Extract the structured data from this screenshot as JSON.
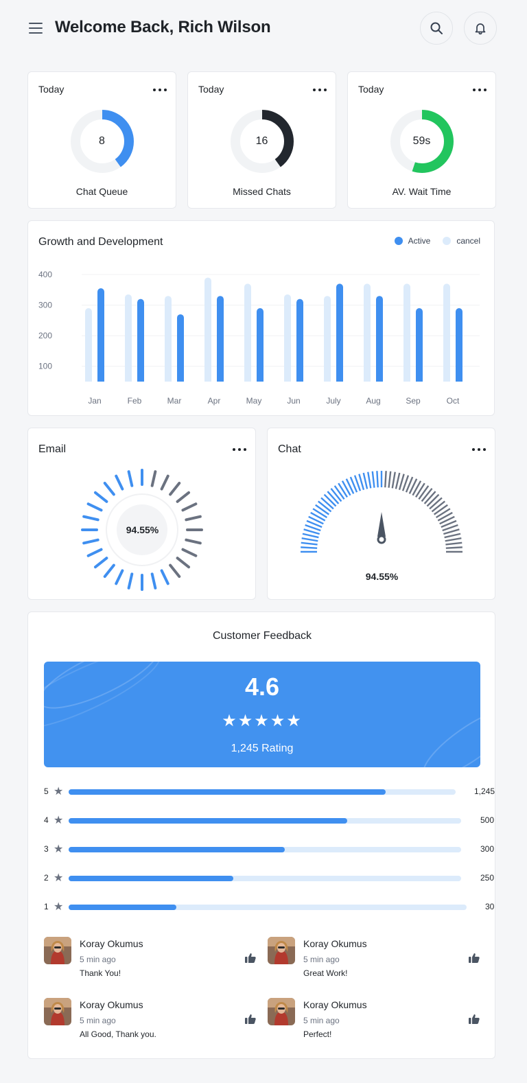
{
  "header": {
    "title": "Welcome Back, Rich Wilson"
  },
  "stats": [
    {
      "period": "Today",
      "value": "8",
      "label": "Chat Queue",
      "progress": 0.4,
      "color": "#3f8ff0"
    },
    {
      "period": "Today",
      "value": "16",
      "label": "Missed Chats",
      "progress": 0.4,
      "color": "#22272e"
    },
    {
      "period": "Today",
      "value": "59s",
      "label": "AV. Wait Time",
      "progress": 0.55,
      "color": "#22c55e"
    }
  ],
  "growth": {
    "title": "Growth and Development",
    "legend": {
      "active": "Active",
      "cancel": "cancel"
    },
    "colors": {
      "active": "#3f8ff0",
      "cancel": "#dcebfb"
    }
  },
  "chart_data": {
    "type": "bar",
    "title": "Growth and Development",
    "categories": [
      "Jan",
      "Feb",
      "Mar",
      "Apr",
      "May",
      "Jun",
      "July",
      "Aug",
      "Sep",
      "Oct"
    ],
    "series": [
      {
        "name": "cancel",
        "values": [
          290,
          335,
          330,
          390,
          370,
          335,
          330,
          370,
          370,
          370
        ]
      },
      {
        "name": "Active",
        "values": [
          355,
          320,
          270,
          330,
          290,
          320,
          370,
          330,
          290,
          290
        ]
      }
    ],
    "yticks": [
      100,
      200,
      300,
      400
    ],
    "ylim": [
      50,
      400
    ],
    "legend_position": "top-right"
  },
  "email": {
    "title": "Email",
    "value": "94.55%",
    "progress": 0.6,
    "colors": {
      "filled": "#3f8ff0",
      "rest": "#6b7280"
    }
  },
  "chat": {
    "title": "Chat",
    "value": "94.55%",
    "progress": 0.5,
    "colors": {
      "filled": "#3f8ff0",
      "rest": "#6b7280"
    }
  },
  "feedback": {
    "title": "Customer Feedback",
    "score": "4.6",
    "stars": "★★★★★",
    "rating_count": "1,245 Rating",
    "rows": [
      {
        "stars": "5",
        "count": "1,245",
        "fill": 0.82
      },
      {
        "stars": "4",
        "count": "500",
        "fill": 0.71
      },
      {
        "stars": "3",
        "count": "300",
        "fill": 0.55
      },
      {
        "stars": "2",
        "count": "250",
        "fill": 0.42
      },
      {
        "stars": "1",
        "count": "30",
        "fill": 0.27
      }
    ],
    "reviews": [
      {
        "name": "Koray Okumus",
        "time": "5 min ago",
        "text": "Thank You!"
      },
      {
        "name": "Koray Okumus",
        "time": "5 min ago",
        "text": "Great Work!"
      },
      {
        "name": "Koray Okumus",
        "time": "5 min ago",
        "text": "All Good, Thank you."
      },
      {
        "name": "Koray Okumus",
        "time": "5 min ago",
        "text": "Perfect!"
      }
    ]
  }
}
